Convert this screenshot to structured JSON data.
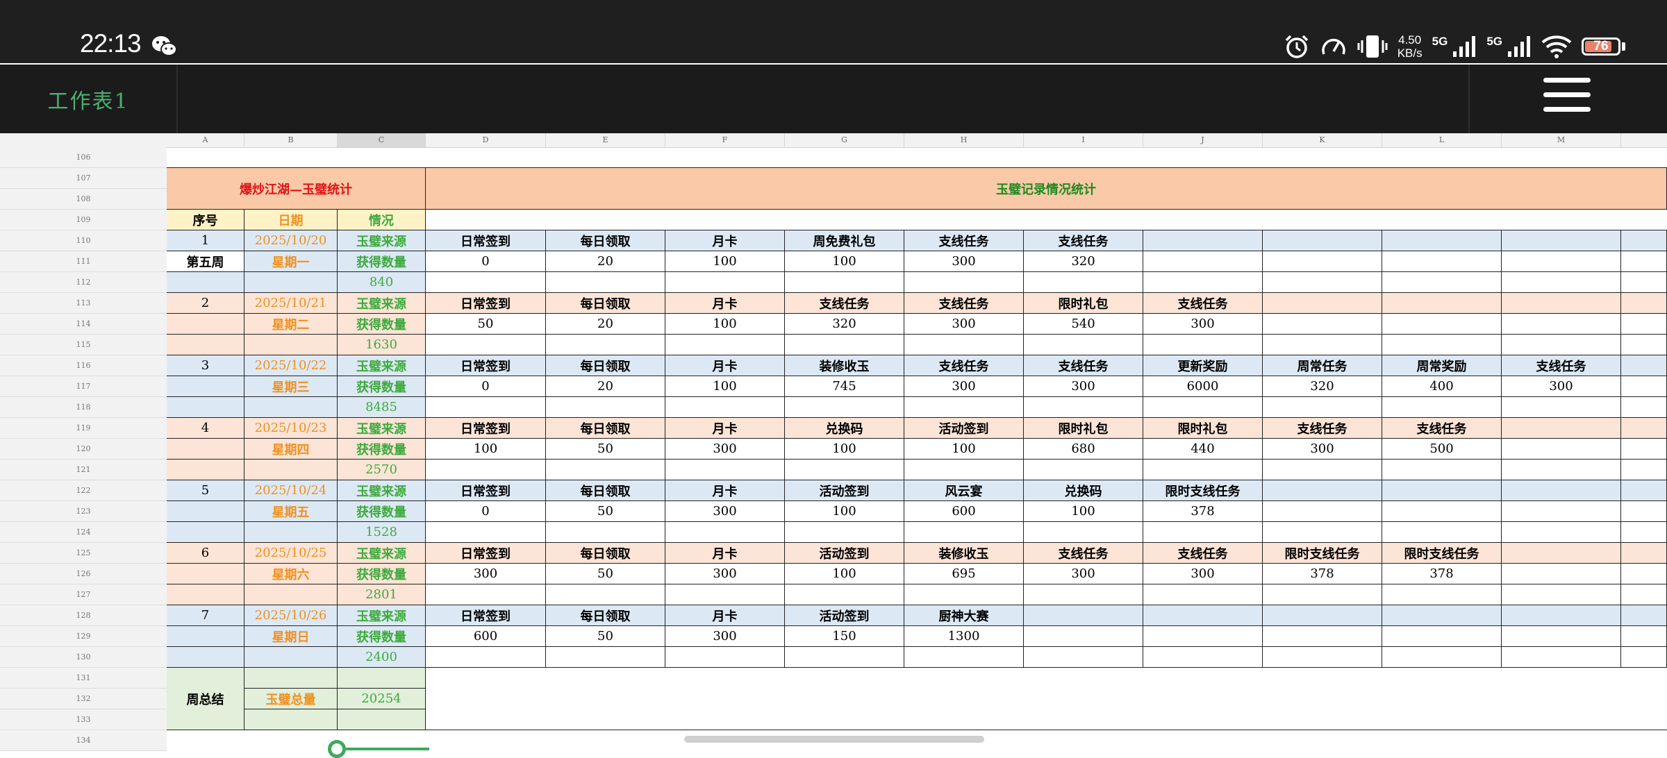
{
  "status_bar": {
    "time": "22:13",
    "net_speed_value": "4.50",
    "net_speed_unit": "KB/s",
    "network_1": "5G",
    "network_2": "5G",
    "battery": "76",
    "icons": [
      "wechat-icon",
      "alarm-icon",
      "speed-icon",
      "vibrate-icon",
      "signal-icon",
      "wifi-icon",
      "battery-icon"
    ]
  },
  "toolbar": {
    "sheet_name": "工作表1",
    "menu_icon": "hamburger-menu-icon"
  },
  "columns": [
    "A",
    "B",
    "C",
    "D",
    "E",
    "F",
    "G",
    "H",
    "I",
    "J",
    "K",
    "L",
    "M"
  ],
  "selected_column": "C",
  "row_numbers": [
    "106",
    "107",
    "108",
    "109",
    "110",
    "111",
    "112",
    "113",
    "114",
    "115",
    "116",
    "117",
    "118",
    "119",
    "120",
    "121",
    "122",
    "123",
    "124",
    "125",
    "126",
    "127",
    "128",
    "129",
    "130",
    "131",
    "132",
    "133",
    "134"
  ],
  "colors": {
    "title_bg": "#f9c9a8",
    "header_bg": "#fff2c7",
    "blue_band": "#dce9f5",
    "peach_band": "#fce4d6",
    "summary_bg": "#e2efda",
    "orange_text": "#f0901e",
    "green_text": "#3daa3d",
    "red_text": "#e01414"
  },
  "sheet": {
    "left_title": "爆炒江湖—玉璧统计",
    "right_title": "玉璧记录情况统计",
    "header": {
      "seq": "序号",
      "date": "日期",
      "info": "情况"
    },
    "source_label": "玉璧来源",
    "amount_label": "获得数量",
    "days": [
      {
        "seq": "1",
        "week": "第五周",
        "date": "2025/10/20",
        "weekday": "星期一",
        "total": "840",
        "band": "blue",
        "sources": [
          "日常签到",
          "每日领取",
          "月卡",
          "周免费礼包",
          "支线任务",
          "支线任务"
        ],
        "amounts": [
          "0",
          "20",
          "100",
          "100",
          "300",
          "320"
        ]
      },
      {
        "seq": "2",
        "week": "",
        "date": "2025/10/21",
        "weekday": "星期二",
        "total": "1630",
        "band": "peach",
        "sources": [
          "日常签到",
          "每日领取",
          "月卡",
          "支线任务",
          "支线任务",
          "限时礼包",
          "支线任务"
        ],
        "amounts": [
          "50",
          "20",
          "100",
          "320",
          "300",
          "540",
          "300"
        ]
      },
      {
        "seq": "3",
        "week": "",
        "date": "2025/10/22",
        "weekday": "星期三",
        "total": "8485",
        "band": "blue",
        "sources": [
          "日常签到",
          "每日领取",
          "月卡",
          "装修收玉",
          "支线任务",
          "支线任务",
          "更新奖励",
          "周常任务",
          "周常奖励",
          "支线任务"
        ],
        "amounts": [
          "0",
          "20",
          "100",
          "745",
          "300",
          "300",
          "6000",
          "320",
          "400",
          "300"
        ]
      },
      {
        "seq": "4",
        "week": "",
        "date": "2025/10/23",
        "weekday": "星期四",
        "total": "2570",
        "band": "peach",
        "sources": [
          "日常签到",
          "每日领取",
          "月卡",
          "兑换码",
          "活动签到",
          "限时礼包",
          "限时礼包",
          "支线任务",
          "支线任务"
        ],
        "amounts": [
          "100",
          "50",
          "300",
          "100",
          "100",
          "680",
          "440",
          "300",
          "500"
        ]
      },
      {
        "seq": "5",
        "week": "",
        "date": "2025/10/24",
        "weekday": "星期五",
        "total": "1528",
        "band": "blue",
        "sources": [
          "日常签到",
          "每日领取",
          "月卡",
          "活动签到",
          "风云宴",
          "兑换码",
          "限时支线任务"
        ],
        "amounts": [
          "0",
          "50",
          "300",
          "100",
          "600",
          "100",
          "378"
        ]
      },
      {
        "seq": "6",
        "week": "",
        "date": "2025/10/25",
        "weekday": "星期六",
        "total": "2801",
        "band": "peach",
        "sources": [
          "日常签到",
          "每日领取",
          "月卡",
          "活动签到",
          "装修收玉",
          "支线任务",
          "支线任务",
          "限时支线任务",
          "限时支线任务"
        ],
        "amounts": [
          "300",
          "50",
          "300",
          "100",
          "695",
          "300",
          "300",
          "378",
          "378"
        ]
      },
      {
        "seq": "7",
        "week": "",
        "date": "2025/10/26",
        "weekday": "星期日",
        "total": "2400",
        "band": "blue",
        "sources": [
          "日常签到",
          "每日领取",
          "月卡",
          "活动签到",
          "厨神大赛"
        ],
        "amounts": [
          "600",
          "50",
          "300",
          "150",
          "1300"
        ]
      }
    ],
    "summary": {
      "label": "周总结",
      "total_label": "玉璧总量",
      "total": "20254"
    }
  }
}
